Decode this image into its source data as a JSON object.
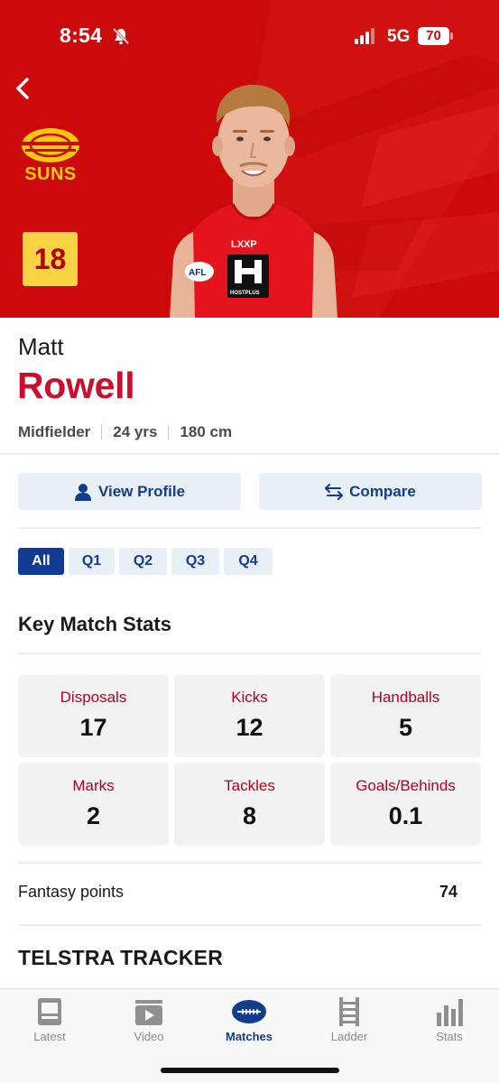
{
  "status_bar": {
    "time": "8:54",
    "network": "5G",
    "battery": "70"
  },
  "club": {
    "logo_text": "SUNS",
    "jersey_number": "18"
  },
  "player": {
    "first_name": "Matt",
    "last_name": "Rowell",
    "position": "Midfielder",
    "age": "24 yrs",
    "height": "180 cm"
  },
  "actions": {
    "view_profile": "View Profile",
    "compare": "Compare"
  },
  "quarter_tabs": [
    {
      "label": "All",
      "active": true
    },
    {
      "label": "Q1",
      "active": false
    },
    {
      "label": "Q2",
      "active": false
    },
    {
      "label": "Q3",
      "active": false
    },
    {
      "label": "Q4",
      "active": false
    }
  ],
  "key_match_stats": {
    "title": "Key Match Stats",
    "items": [
      {
        "label": "Disposals",
        "value": "17"
      },
      {
        "label": "Kicks",
        "value": "12"
      },
      {
        "label": "Handballs",
        "value": "5"
      },
      {
        "label": "Marks",
        "value": "2"
      },
      {
        "label": "Tackles",
        "value": "8"
      },
      {
        "label": "Goals/Behinds",
        "value": "0.1"
      }
    ]
  },
  "fantasy": {
    "label": "Fantasy points",
    "value": "74"
  },
  "tracker": {
    "title": "TELSTRA TRACKER"
  },
  "tabbar": {
    "items": [
      {
        "label": "Latest",
        "icon": "latest-icon",
        "active": false
      },
      {
        "label": "Video",
        "icon": "video-icon",
        "active": false
      },
      {
        "label": "Matches",
        "icon": "matches-icon",
        "active": true
      },
      {
        "label": "Ladder",
        "icon": "ladder-icon",
        "active": false
      },
      {
        "label": "Stats",
        "icon": "stats-icon",
        "active": false
      }
    ]
  },
  "colors": {
    "hero_red": "#cc0a0a",
    "accent_red": "#c8102e",
    "nav_blue": "#123c8c",
    "badge_yellow": "#f8d343",
    "logo_gold": "#f6c80f"
  }
}
